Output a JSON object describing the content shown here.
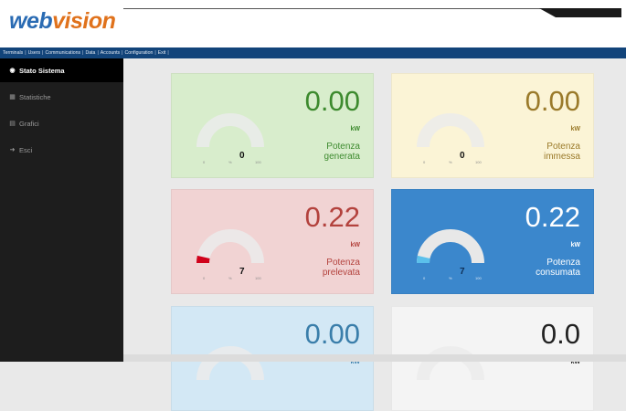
{
  "brand": {
    "logo_part1": "web",
    "logo_part2": "vision"
  },
  "nav": {
    "items": [
      "Terminals",
      "Users",
      "Communications",
      "Data",
      "Accounts",
      "Configuration",
      "Exit"
    ],
    "separator": "|"
  },
  "sidebar": {
    "items": [
      {
        "label": "Stato Sistema",
        "icon": "dashboard-icon"
      },
      {
        "label": "Statistiche",
        "icon": "table-icon"
      },
      {
        "label": "Grafici",
        "icon": "bar-chart-icon"
      },
      {
        "label": "Esci",
        "icon": "logout-icon"
      }
    ]
  },
  "panels": [
    {
      "value": "0.00",
      "unit": "kW",
      "label_line1": "Potenza",
      "label_line2": "generata",
      "gauge_value": "0",
      "gauge_min": "0",
      "gauge_mid": "%",
      "gauge_max": "100",
      "level": 0,
      "bg": "#d8edcc",
      "value_color": "#3d8a2e",
      "label_color": "#3d8a2e",
      "gauge_fill": "#e74c3c"
    },
    {
      "value": "0.00",
      "unit": "kW",
      "label_line1": "Potenza",
      "label_line2": "immessa",
      "gauge_value": "0",
      "gauge_min": "0",
      "gauge_mid": "%",
      "gauge_max": "100",
      "level": 0,
      "bg": "#fbf4d6",
      "value_color": "#9a7a2a",
      "label_color": "#9a7a2a",
      "gauge_fill": "#e74c3c"
    },
    {
      "value": "0.22",
      "unit": "kW",
      "label_line1": "Potenza",
      "label_line2": "prelevata",
      "gauge_value": "7",
      "gauge_min": "0",
      "gauge_mid": "%",
      "gauge_max": "100",
      "level": 0.07,
      "bg": "#f1d3d3",
      "value_color": "#b3423d",
      "label_color": "#b3423d",
      "gauge_fill": "#d0021b"
    },
    {
      "value": "0.22",
      "unit": "kW",
      "label_line1": "Potenza",
      "label_line2": "consumata",
      "gauge_value": "7",
      "gauge_min": "0",
      "gauge_mid": "%",
      "gauge_max": "100",
      "level": 0.07,
      "bg": "#3b87cc",
      "value_color": "#ffffff",
      "label_color": "#ffffff",
      "gauge_fill": "#5bc0eb"
    },
    {
      "value": "0.00",
      "unit": "kW",
      "label_line1": "",
      "label_line2": "",
      "gauge_value": "",
      "gauge_min": "",
      "gauge_mid": "",
      "gauge_max": "",
      "level": 0,
      "bg": "#d3e8f5",
      "value_color": "#3a7eaa",
      "label_color": "#3a7eaa",
      "gauge_fill": "#5bc0eb"
    },
    {
      "value": "0.0",
      "unit": "kW",
      "label_line1": "",
      "label_line2": "",
      "gauge_value": "",
      "gauge_min": "",
      "gauge_mid": "",
      "gauge_max": "",
      "level": 0,
      "bg": "#f4f4f4",
      "value_color": "#222222",
      "label_color": "#222222",
      "gauge_fill": "#e74c3c"
    }
  ]
}
